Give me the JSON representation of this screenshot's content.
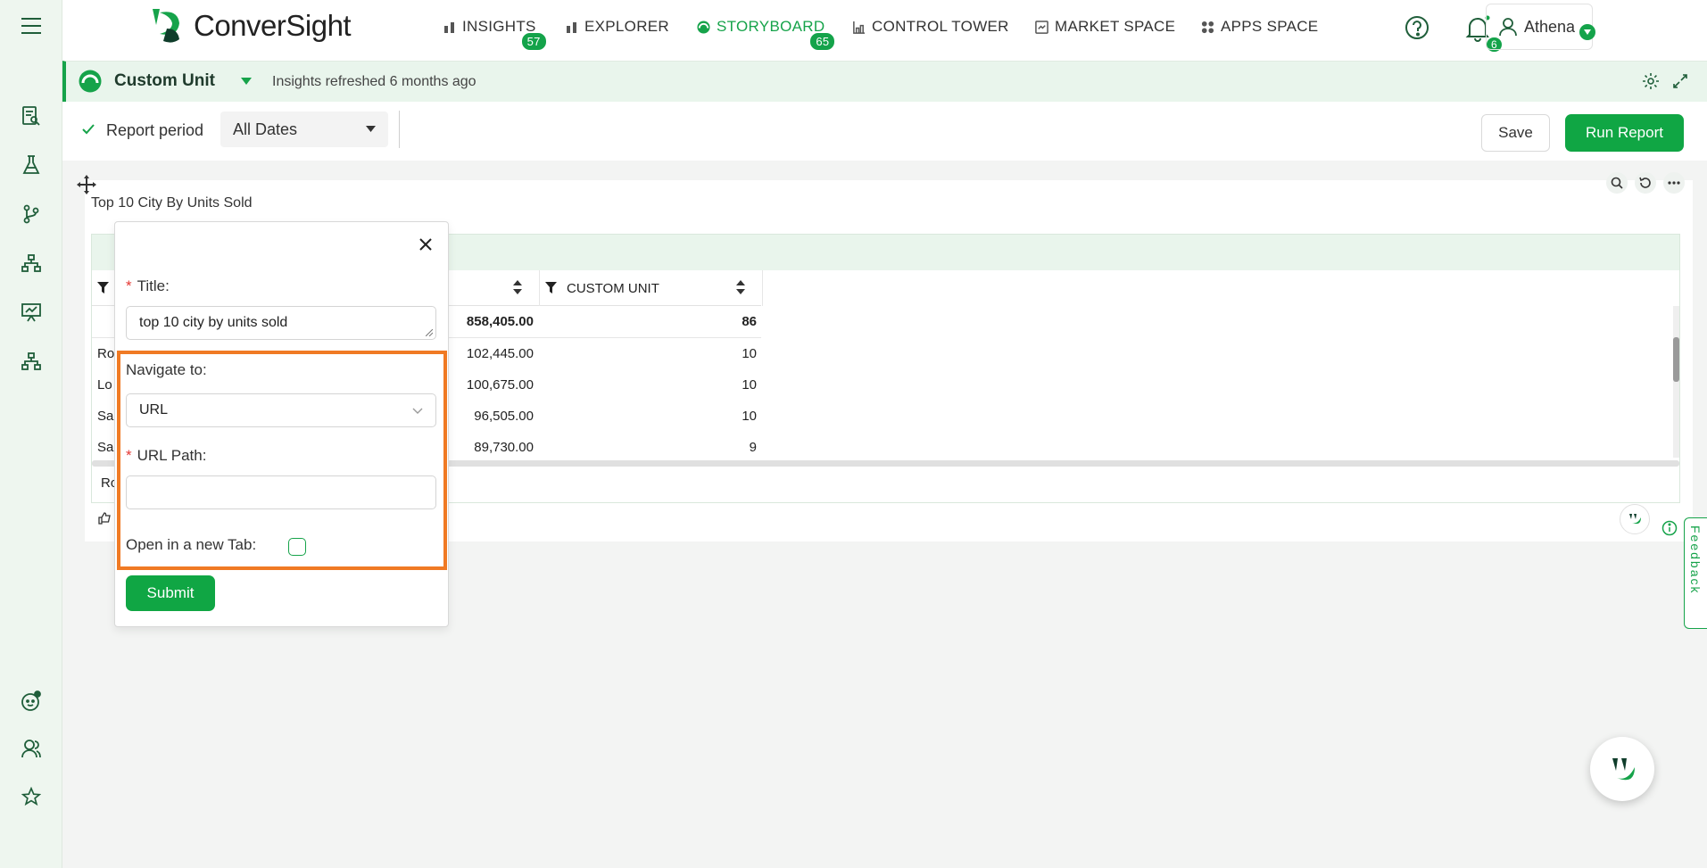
{
  "sidebar": {
    "items": [
      {
        "name": "reports",
        "icon": "report-search-icon"
      },
      {
        "name": "lab",
        "icon": "flask-icon"
      },
      {
        "name": "workflow",
        "icon": "branch-icon"
      },
      {
        "name": "hierarchy",
        "icon": "sitemap-icon"
      },
      {
        "name": "presentation",
        "icon": "presentation-icon"
      },
      {
        "name": "hierarchy-2",
        "icon": "sitemap-icon"
      }
    ],
    "bottom": [
      "assistant-icon",
      "users-icon",
      "star-icon"
    ]
  },
  "header": {
    "brand": "ConverSight",
    "nav": [
      {
        "label": "INSIGHTS",
        "badge": "57",
        "active": false
      },
      {
        "label": "EXPLORER",
        "badge": "",
        "active": false
      },
      {
        "label": "STORYBOARD",
        "badge": "65",
        "active": true
      },
      {
        "label": "CONTROL TOWER",
        "badge": "",
        "active": false
      },
      {
        "label": "MARKET SPACE",
        "badge": "",
        "active": false
      },
      {
        "label": "APPS SPACE",
        "badge": "",
        "active": false
      }
    ],
    "notifications_count": "6",
    "user_name": "Athena"
  },
  "subbar": {
    "title": "Custom Unit",
    "refresh_text": "Insights refreshed 6 months ago"
  },
  "toolbar": {
    "report_period_label": "Report period",
    "date_filter_value": "All Dates",
    "save_label": "Save",
    "run_report_label": "Run Report"
  },
  "widget": {
    "title": "Top 10 City By Units Sold",
    "columns": [
      "",
      "CUSTOM UNIT"
    ],
    "total_row": {
      "value": "858,405.00",
      "unit": "86"
    },
    "rows": [
      {
        "city": "Ro",
        "value": "102,445.00",
        "unit": "10"
      },
      {
        "city": "Lo",
        "value": "100,675.00",
        "unit": "10"
      },
      {
        "city": "Sa",
        "value": "96,505.00",
        "unit": "10"
      },
      {
        "city": "Sa",
        "value": "89,730.00",
        "unit": "9"
      }
    ],
    "footer_text": "Ro"
  },
  "popup": {
    "title_label": "Title:",
    "title_value": "top 10 city by units sold",
    "navigate_label": "Navigate to:",
    "navigate_value": "URL",
    "url_path_label": "URL Path:",
    "url_path_value": "",
    "new_tab_label": "Open in a new Tab:",
    "new_tab_checked": false,
    "submit_label": "Submit"
  },
  "feedback_label": "Feedback",
  "colors": {
    "brand": "#16a34a",
    "highlight": "#f07a24",
    "sidebar_bg": "#eef6ef"
  }
}
